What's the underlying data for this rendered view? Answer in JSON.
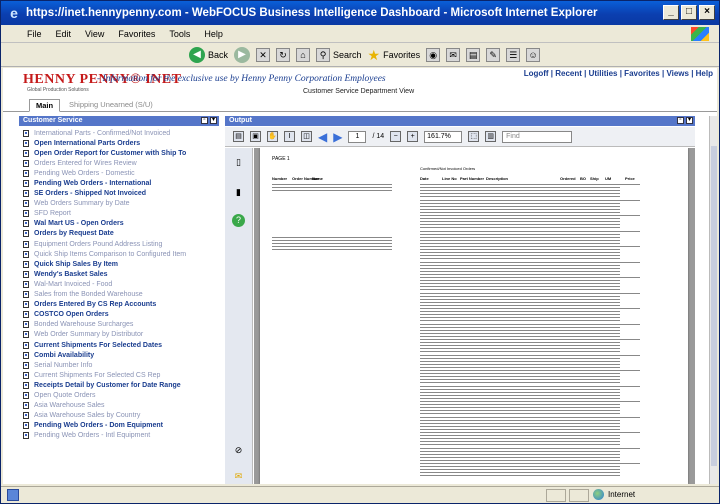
{
  "window": {
    "title": "https://inet.hennypenny.com - WebFOCUS Business Intelligence Dashboard - Microsoft Internet Explorer",
    "controls": [
      "_",
      "□",
      "×"
    ]
  },
  "menu": [
    "File",
    "Edit",
    "View",
    "Favorites",
    "Tools",
    "Help"
  ],
  "toolbar": {
    "back_label": "Back",
    "search_label": "Search",
    "favorites_label": "Favorites"
  },
  "site": {
    "top_links": "Logoff | Recent | Utilities | Favorites | Views | Help",
    "brand": "HENNY PENNY",
    "brand_suffix": "® INET",
    "brand_sub": "Global Production Solutions",
    "tagline": "- Information for the exclusive use by Henny Penny Corporation Employees",
    "dept_view": "Customer Service Department View"
  },
  "tabs": [
    {
      "label": "Main"
    },
    {
      "label": "Shipping Unearned (S/U)"
    }
  ],
  "left_panel": {
    "title": "Customer Service",
    "items": [
      {
        "label": "International Parts - Confirmed/Not Invoiced",
        "style": "muted"
      },
      {
        "label": "Open International Parts Orders",
        "style": "bold"
      },
      {
        "label": "Open Order Report for Customer with Ship To",
        "style": "bold"
      },
      {
        "label": "Orders Entered for Wires Review",
        "style": "muted"
      },
      {
        "label": "Pending Web Orders - Domestic",
        "style": "muted"
      },
      {
        "label": "Pending Web Orders - International",
        "style": "bold"
      },
      {
        "label": "SE Orders - Shipped Not Invoiced",
        "style": "bold"
      },
      {
        "label": "Web Orders Summary by Date",
        "style": "muted"
      },
      {
        "label": "SFD Report",
        "style": "muted"
      },
      {
        "label": "Wal Mart US - Open Orders",
        "style": "bold"
      },
      {
        "label": "Orders by Request Date",
        "style": "bold"
      },
      {
        "label": "Equipment Orders Pound Address Listing",
        "style": "muted"
      },
      {
        "label": "Quick Ship Items Comparison to Configured Item",
        "style": "muted"
      },
      {
        "label": "Quick Ship Sales By Item",
        "style": "bold"
      },
      {
        "label": "Wendy's Basket Sales",
        "style": "bold"
      },
      {
        "label": "Wal-Mart Invoiced - Food",
        "style": "muted"
      },
      {
        "label": "Sales from the Bonded Warehouse",
        "style": "muted"
      },
      {
        "label": "Orders Entered By CS Rep Accounts",
        "style": "bold"
      },
      {
        "label": "COSTCO Open Orders",
        "style": "bold"
      },
      {
        "label": "Bonded Warehouse Surcharges",
        "style": "muted"
      },
      {
        "label": "Web Order Summary by Distributor",
        "style": "muted"
      },
      {
        "label": "Current Shipments For Selected Dates",
        "style": "bold"
      },
      {
        "label": "Combi Availability",
        "style": "bold"
      },
      {
        "label": "Serial Number Info",
        "style": "muted"
      },
      {
        "label": "Current Shipments For Selected CS Rep",
        "style": "muted"
      },
      {
        "label": "Receipts Detail by Customer for Date Range",
        "style": "bold"
      },
      {
        "label": "Open Quote Orders",
        "style": "muted"
      },
      {
        "label": "Asia Warehouse Sales",
        "style": "muted"
      },
      {
        "label": "Asia Warehouse Sales by Country",
        "style": "muted"
      },
      {
        "label": "Pending Web Orders - Dom Equipment",
        "style": "bold"
      },
      {
        "label": "Pending Web Orders - Intl Equipment",
        "style": "muted"
      }
    ]
  },
  "right_panel": {
    "title": "Output",
    "page_current": "1",
    "page_total": "/ 14",
    "zoom": "161.7%",
    "find_placeholder": "Find",
    "report": {
      "page_label": "PAGE 1",
      "title": "Confirmed/Not Invoiced Orders",
      "columns": [
        "Number",
        "Order Number",
        "Name",
        "Date",
        "Line No",
        "Part Number",
        "Description",
        "Ordered",
        "BO",
        "Ship",
        "UM",
        "Price"
      ]
    }
  },
  "status": {
    "zone": "Internet"
  }
}
